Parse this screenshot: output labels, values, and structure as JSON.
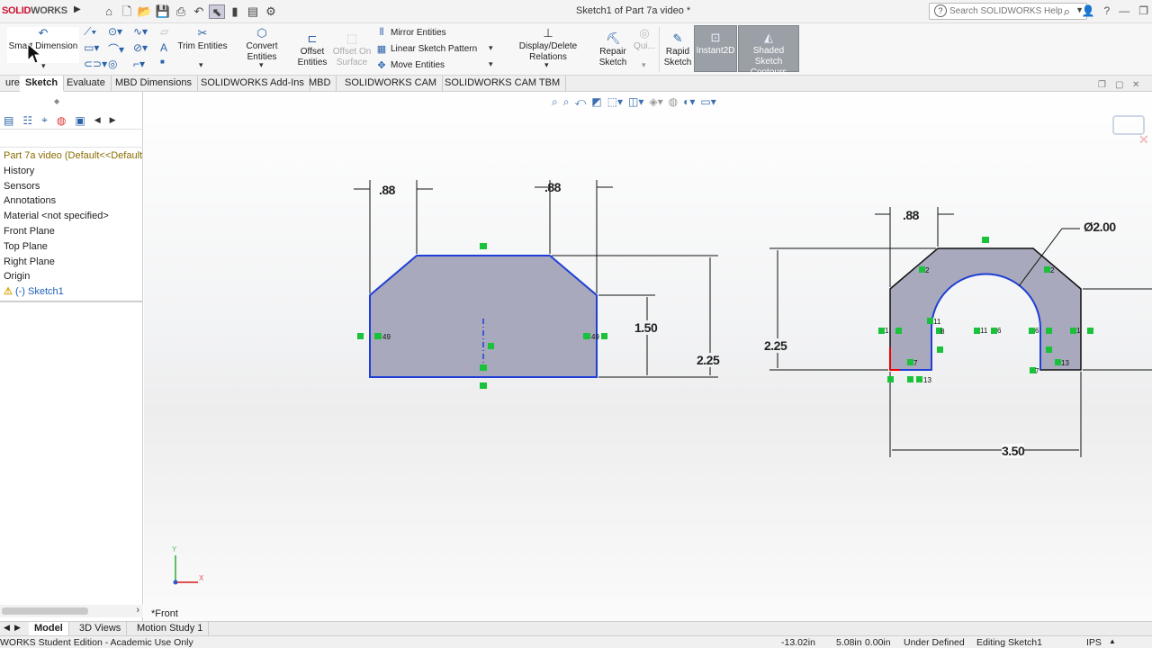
{
  "app": {
    "logo_a": "SOLID",
    "logo_b": "WORKS",
    "window_title": "Sketch1 of Part 7a video *",
    "search_placeholder": "Search SOLIDWORKS Help"
  },
  "ribbon": {
    "smart_dimension": "Smart Dimension",
    "trim_entities": "Trim Entities",
    "convert_entities": "Convert Entities",
    "offset_entities_1": "Offset",
    "offset_entities_2": "Entities",
    "offset_on_surface_1": "Offset On",
    "offset_on_surface_2": "Surface",
    "mirror_entities": "Mirror Entities",
    "linear_sketch_pattern": "Linear Sketch Pattern",
    "move_entities": "Move Entities",
    "display_delete_relations": "Display/Delete Relations",
    "repair_sketch_1": "Repair",
    "repair_sketch_2": "Sketch",
    "quick_snaps": "Qui...",
    "rapid_sketch_1": "Rapid",
    "rapid_sketch_2": "Sketch",
    "instant2d": "Instant2D",
    "shaded_contours_1": "Shaded Sketch",
    "shaded_contours_2": "Contours"
  },
  "tabs": [
    {
      "label": "ures"
    },
    {
      "label": "Sketch"
    },
    {
      "label": "Evaluate"
    },
    {
      "label": "MBD Dimensions"
    },
    {
      "label": "SOLIDWORKS Add-Ins"
    },
    {
      "label": "MBD"
    },
    {
      "label": "SOLIDWORKS CAM"
    },
    {
      "label": "SOLIDWORKS CAM TBM"
    }
  ],
  "tree": {
    "root": "Part 7a video  (Default<<Default",
    "items": [
      {
        "label": "History"
      },
      {
        "label": "Sensors"
      },
      {
        "label": "Annotations"
      },
      {
        "label": "Material <not specified>"
      },
      {
        "label": "Front Plane"
      },
      {
        "label": "Top Plane"
      },
      {
        "label": "Right Plane"
      },
      {
        "label": "Origin"
      }
    ],
    "sketch": "(-) Sketch1",
    "warn_symbol": "⚠"
  },
  "sketch": {
    "left_shape": {
      "dim_top_left": ".88",
      "dim_top_right": ".88",
      "dim_height_inner": "1.50",
      "dim_height_outer": "2.25",
      "rel_left": "49",
      "rel_right": "49"
    },
    "right_shape": {
      "dim_top": ".88",
      "dim_diameter": "Ø2.00",
      "dim_height": "2.25",
      "dim_width": "3.50",
      "rel_2a": "2",
      "rel_2b": "2",
      "rel_1a": "1",
      "rel_1b": "1",
      "rel_11a": "11",
      "rel_11b": "11",
      "rel_6a": "6",
      "rel_6b": "6",
      "rel_7a": "7",
      "rel_7b": "7",
      "rel_13a": "13",
      "rel_13b": "13",
      "rel_8": "8"
    },
    "triad_x": "X",
    "triad_y": "Y",
    "view_label": "*Front"
  },
  "bottom_tabs": [
    {
      "label": "Model"
    },
    {
      "label": "3D Views"
    },
    {
      "label": "Motion Study 1"
    }
  ],
  "status": {
    "edition": "WORKS Student Edition - Academic Use Only",
    "x": "-13.02in",
    "y": "5.08in",
    "z": "0.00in",
    "defined": "Under Defined",
    "editing": "Editing Sketch1",
    "units": "IPS"
  },
  "colors": {
    "sketch_line": "#1f3fd6",
    "fill": "#a8a9bc",
    "relation": "#19c23a",
    "brand": "#c8102e"
  }
}
